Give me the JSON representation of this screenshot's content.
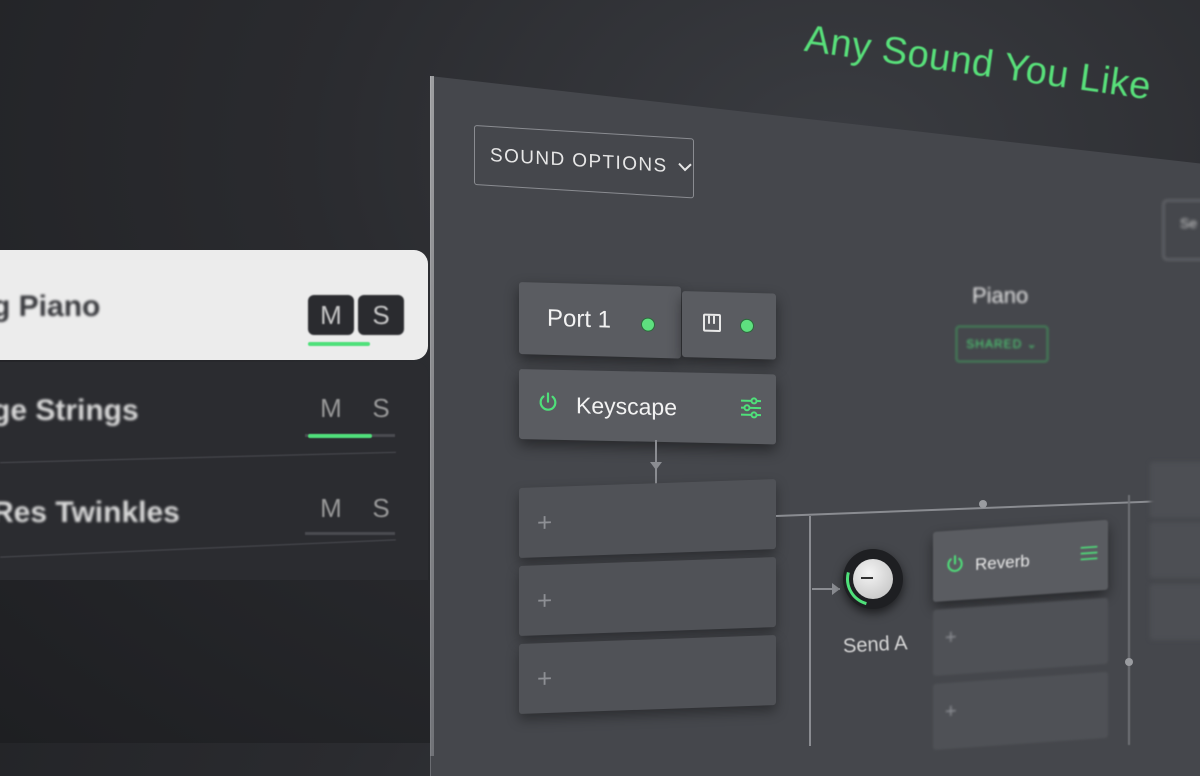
{
  "headline": "Any Sound You Like",
  "tracks": [
    {
      "name": "g Piano",
      "mute_label": "M",
      "solo_label": "S",
      "active": true
    },
    {
      "name": "ge Strings",
      "mute_label": "M",
      "solo_label": "S",
      "active": false
    },
    {
      "name": "Res Twinkles",
      "mute_label": "M",
      "solo_label": "S",
      "active": false
    }
  ],
  "panel": {
    "sound_options_label": "SOUND OPTIONS",
    "port_label": "Port 1",
    "plugin_label": "Keyscape",
    "empty_slot_symbol": "+",
    "send_label": "Send A",
    "reverb_label": "Reverb",
    "instrument_title": "Piano",
    "shared_label": "SHARED",
    "right_button_label": "Se"
  },
  "colors": {
    "accent_green": "#4fe07a",
    "panel_bg": "#45474c",
    "card_bg": "#5a5c61",
    "page_bg": "#2a2b2f"
  },
  "icons": {
    "chevron": "chevron-down-icon",
    "power": "power-icon",
    "sliders": "sliders-icon",
    "piano": "piano-keys-icon"
  }
}
